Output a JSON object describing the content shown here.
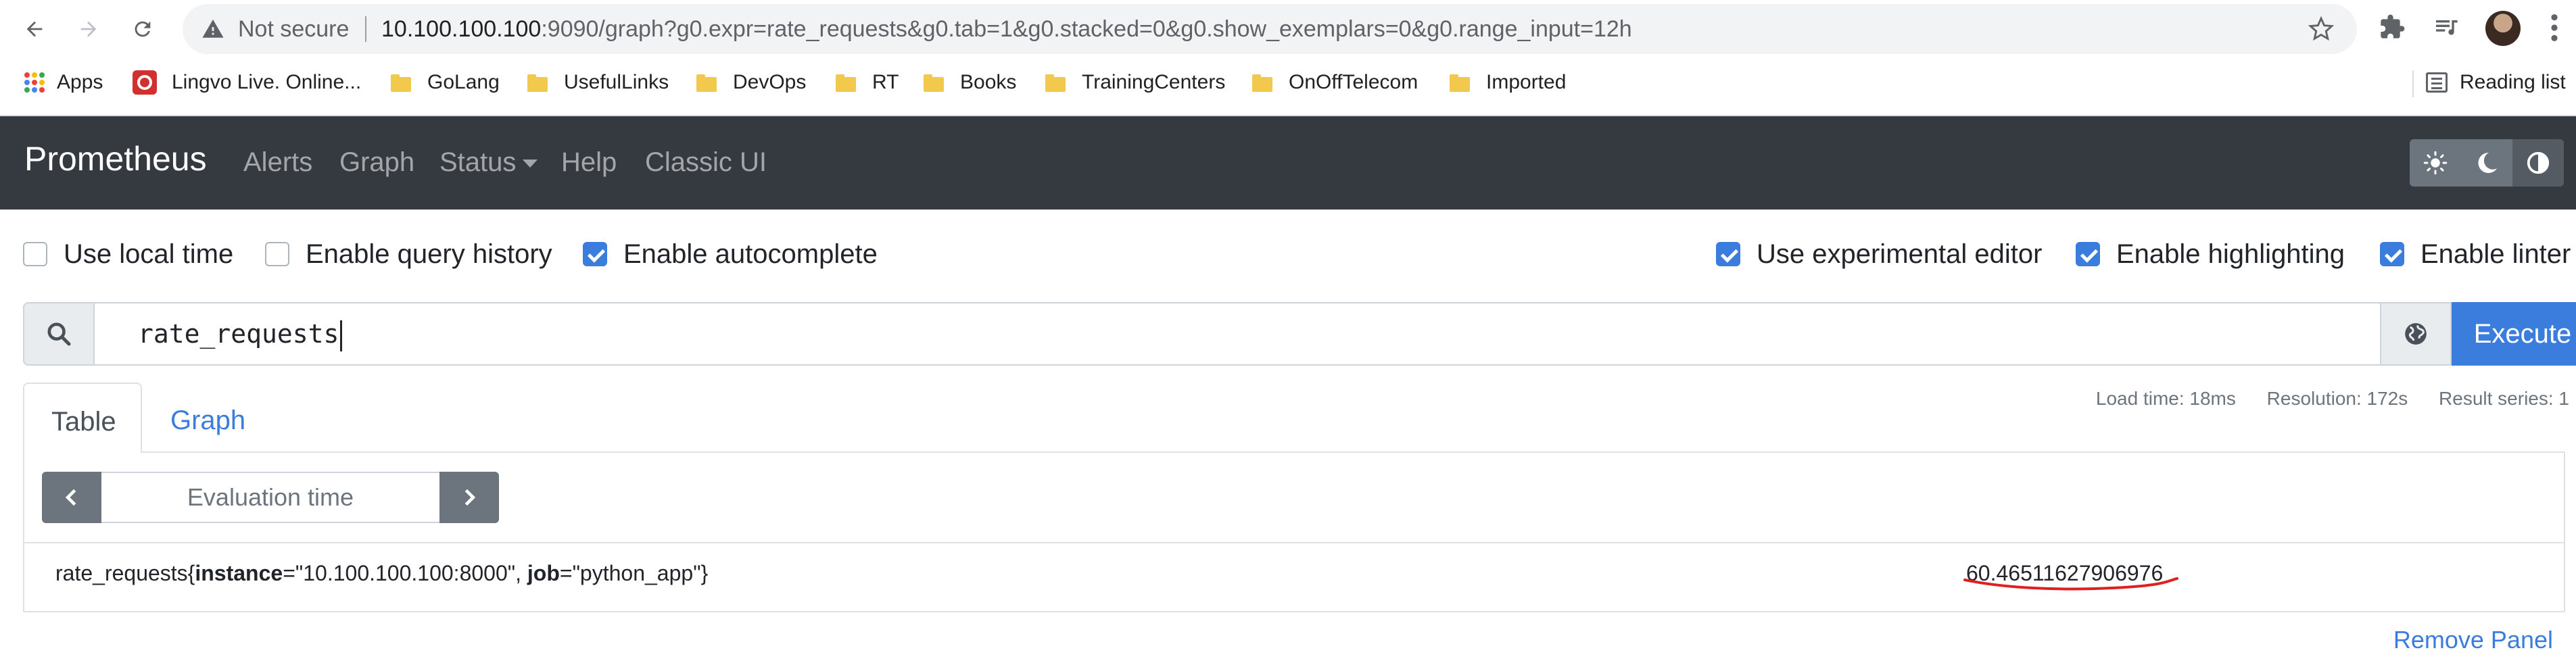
{
  "browser": {
    "not_secure": "Not secure",
    "url_host": "10.100.100.100",
    "url_rest": ":9090/graph?g0.expr=rate_requests&g0.tab=1&g0.stacked=0&g0.show_exemplars=0&g0.range_input=12h",
    "bookmarks": [
      "Apps",
      "Lingvo Live. Online...",
      "GoLang",
      "UsefulLinks",
      "DevOps",
      "RT",
      "Books",
      "TrainingCenters",
      "OnOffTelecom",
      "Imported"
    ],
    "reading_list": "Reading list"
  },
  "nav": {
    "brand": "Prometheus",
    "links": [
      "Alerts",
      "Graph",
      "Status",
      "Help",
      "Classic UI"
    ]
  },
  "options": [
    {
      "label": "Use local time",
      "checked": false
    },
    {
      "label": "Enable query history",
      "checked": false
    },
    {
      "label": "Enable autocomplete",
      "checked": true
    },
    {
      "label": "Use experimental editor",
      "checked": true
    },
    {
      "label": "Enable highlighting",
      "checked": true
    },
    {
      "label": "Enable linter",
      "checked": true
    }
  ],
  "query": {
    "expression": "rate_requests",
    "execute_label": "Execute"
  },
  "panel": {
    "tabs": [
      "Table",
      "Graph"
    ],
    "active_tab": "Table",
    "stats": {
      "load_time": "Load time: 18ms",
      "resolution": "Resolution: 172s",
      "result_series": "Result series: 1"
    },
    "eval_placeholder": "Evaluation time",
    "result": {
      "metric": "rate_requests",
      "label_1_key": "instance",
      "label_1_value": "\"10.100.100.100:8000\"",
      "label_2_key": "job",
      "label_2_value": "\"python_app\"",
      "value": "60.46511627906976"
    },
    "remove_label": "Remove Panel"
  },
  "colors": {
    "navbar": "#343a40",
    "primary": "#3b7ddd",
    "annotation": "#e02020"
  }
}
